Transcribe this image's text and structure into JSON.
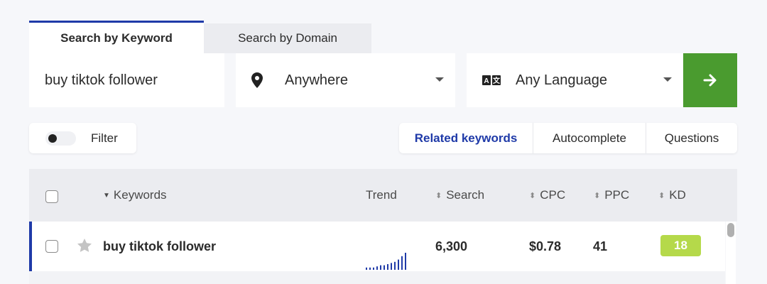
{
  "tabs": {
    "active": "Search by Keyword",
    "inactive": "Search by Domain"
  },
  "search": {
    "keyword": "buy tiktok follower",
    "location": "Anywhere",
    "language": "Any Language",
    "location_icon": "map-pin-icon",
    "language_icon": "translate-icon",
    "go_icon": "arrow-right-icon"
  },
  "filter": {
    "label": "Filter",
    "enabled": false
  },
  "modes": {
    "related": "Related keywords",
    "autocomplete": "Autocomplete",
    "questions": "Questions"
  },
  "table": {
    "columns": {
      "keywords": "Keywords",
      "trend": "Trend",
      "search": "Search",
      "cpc": "CPC",
      "ppc": "PPC",
      "kd": "KD"
    },
    "rows": [
      {
        "keyword": "buy tiktok follower",
        "trend": [
          1,
          1,
          1,
          1.5,
          2,
          2,
          2.5,
          3,
          3.5,
          4.5,
          6,
          7.5
        ],
        "search": "6,300",
        "cpc": "$0.78",
        "ppc": "41",
        "kd": "18"
      }
    ]
  },
  "colors": {
    "accent": "#1f3aa8",
    "go_button": "#4a9b2f",
    "kd_badge": "#b5d94a"
  }
}
